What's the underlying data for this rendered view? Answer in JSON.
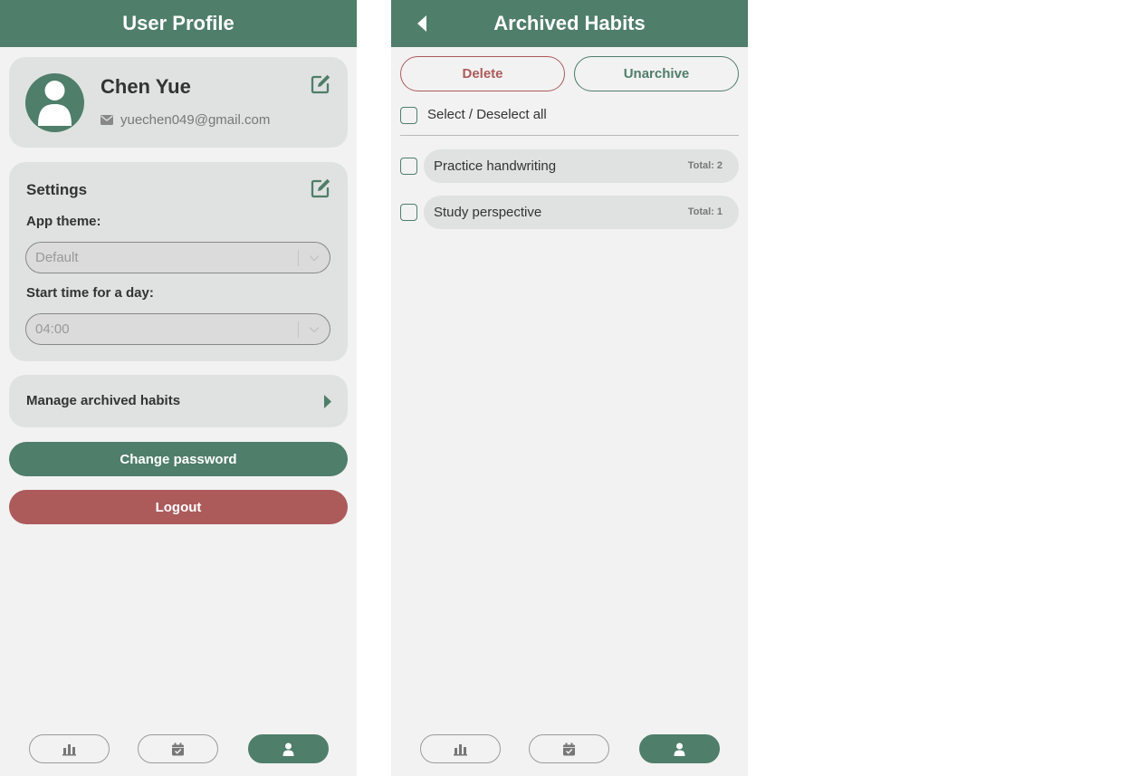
{
  "profile_screen": {
    "header": {
      "title": "User Profile"
    },
    "profile": {
      "name": "Chen Yue",
      "email": "yuechen049@gmail.com"
    },
    "settings": {
      "title": "Settings",
      "theme_label": "App theme:",
      "theme_value": "Default",
      "start_time_label": "Start time for a day:",
      "start_time_value": "04:00"
    },
    "manage_archived_label": "Manage archived habits",
    "change_password_label": "Change password",
    "logout_label": "Logout"
  },
  "archived_screen": {
    "header": {
      "title": "Archived Habits"
    },
    "delete_label": "Delete",
    "unarchive_label": "Unarchive",
    "select_all_label": "Select / Deselect all",
    "habits": [
      {
        "name": "Practice handwriting",
        "total": "Total: 2"
      },
      {
        "name": "Study perspective",
        "total": "Total: 1"
      }
    ]
  },
  "bottom_nav": {
    "items": [
      {
        "icon": "bar-chart-icon",
        "active": false
      },
      {
        "icon": "calendar-check-icon",
        "active": false
      },
      {
        "icon": "user-icon",
        "active": true
      }
    ]
  },
  "colors": {
    "primary": "#4f7e6a",
    "danger": "#ad5a5b",
    "card": "#dfe2e0",
    "background": "#f2f2f2"
  }
}
